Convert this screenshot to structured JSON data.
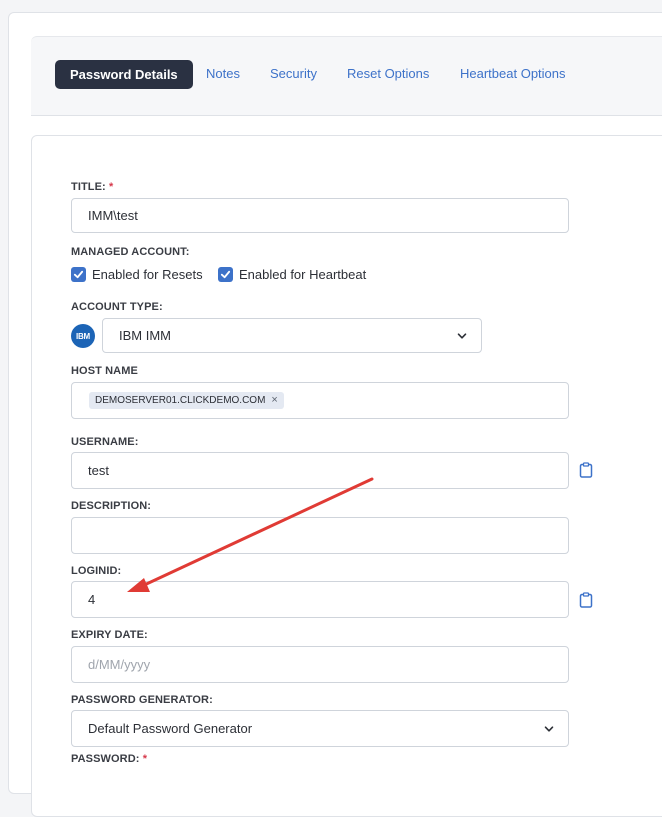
{
  "tabs": [
    {
      "label": "Password Details",
      "active": true
    },
    {
      "label": "Notes"
    },
    {
      "label": "Security"
    },
    {
      "label": "Reset Options"
    },
    {
      "label": "Heartbeat Options"
    }
  ],
  "form": {
    "title_label": "TITLE:",
    "required_mark": "*",
    "title_value": "IMM\\test",
    "managed_label": "MANAGED ACCOUNT:",
    "reset_check_label": "Enabled for Resets",
    "heartbeat_check_label": "Enabled for Heartbeat",
    "account_type_label": "ACCOUNT TYPE:",
    "account_type_icon_text": "IBM",
    "account_type_value": "IBM IMM",
    "host_label": "HOST NAME",
    "host_chip": "DEMOSERVER01.CLICKDEMO.COM",
    "host_chip_remove": "×",
    "username_label": "USERNAME:",
    "username_value": "test",
    "description_label": "DESCRIPTION:",
    "description_value": "",
    "loginid_label": "LOGINID:",
    "loginid_value": "4",
    "expiry_label": "EXPIRY DATE:",
    "expiry_placeholder": "d/MM/yyyy",
    "generator_label": "PASSWORD GENERATOR:",
    "generator_value": "Default Password Generator",
    "password_label": "PASSWORD:"
  },
  "colors": {
    "accent": "#3d72c9",
    "active_tab_bg": "#2a3142",
    "required": "#d6394b",
    "annotation_arrow": "#e03b35"
  },
  "icons": {
    "checkbox": "checkmark-icon",
    "dropdown": "chevron-down-icon",
    "copy": "clipboard-icon",
    "account_type": "ibm-logo-icon"
  }
}
